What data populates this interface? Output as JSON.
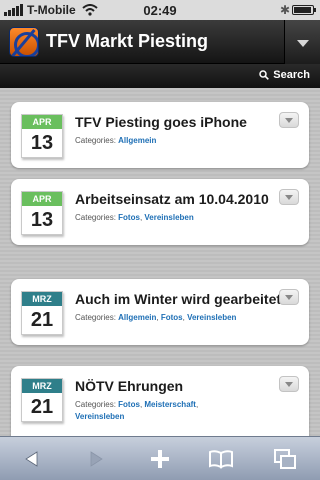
{
  "status_bar": {
    "carrier": "T-Mobile",
    "time": "02:49"
  },
  "header": {
    "title": "TFV Markt Piesting"
  },
  "search": {
    "label": "Search"
  },
  "posts": [
    {
      "month": "APR",
      "day": "13",
      "month_color": "#6abf5e",
      "title": "TFV Piesting goes iPhone",
      "categories_label": "Categories:",
      "categories": [
        "Allgemein"
      ]
    },
    {
      "month": "APR",
      "day": "13",
      "month_color": "#6abf5e",
      "title": "Arbeitseinsatz am 10.04.2010",
      "categories_label": "Categories:",
      "categories": [
        "Fotos",
        "Vereinsleben"
      ]
    },
    {
      "month": "MRZ",
      "day": "21",
      "month_color": "#2f7f8a",
      "title": "Auch im Winter wird gearbeitet",
      "categories_label": "Categories:",
      "categories": [
        "Allgemein",
        "Fotos",
        "Vereinsleben"
      ]
    },
    {
      "month": "MRZ",
      "day": "21",
      "month_color": "#2f7f8a",
      "title": "NÖTV Ehrungen",
      "categories_label": "Categories:",
      "categories": [
        "Fotos",
        "Meisterschaft",
        "Vereinsleben"
      ]
    }
  ],
  "icons": {
    "toolbar": [
      "back-arrow-icon",
      "forward-arrow-icon",
      "plus-icon",
      "bookmarks-book-icon",
      "pages-icon"
    ]
  },
  "colors": {
    "link": "#1e6fb5",
    "header_dark": "#141414",
    "toolbar": "#a7b2c4"
  }
}
